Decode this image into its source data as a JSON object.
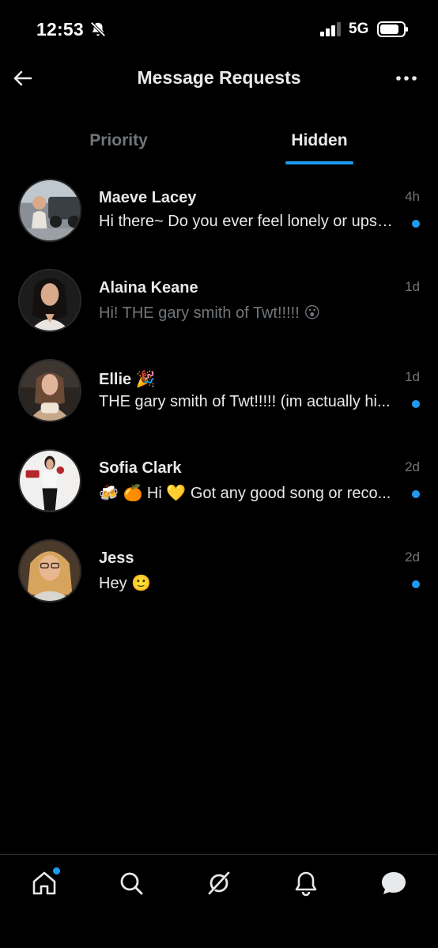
{
  "status_bar": {
    "time": "12:53",
    "network": "5G",
    "icons": [
      "bell-off-icon",
      "signal-icon",
      "battery-icon"
    ]
  },
  "header": {
    "title": "Message Requests",
    "back_icon": "arrow-left-icon",
    "more_icon": "more-horizontal-icon"
  },
  "tabs": [
    {
      "label": "Priority",
      "selected": false
    },
    {
      "label": "Hidden",
      "selected": true
    }
  ],
  "conversations": [
    {
      "name": "Maeve Lacey",
      "time": "4h",
      "snippet": "Hi there~ Do you ever feel lonely or upset sometimes?",
      "unread": true
    },
    {
      "name": "Alaina Keane",
      "time": "1d",
      "snippet": "Hi!   THE gary smith of Twt!!!!! 😮",
      "unread": false
    },
    {
      "name": "Ellie 🎉",
      "time": "1d",
      "snippet": "THE gary smith of Twt!!!!! (im actually hi...",
      "unread": true
    },
    {
      "name": "Sofia Clark",
      "time": "2d",
      "snippet": "🍻 🍊 Hi 💛 Got any good song or reco...",
      "unread": true
    },
    {
      "name": "Jess",
      "time": "2d",
      "snippet": "Hey 🙂",
      "unread": true
    }
  ],
  "bottom_nav": [
    {
      "icon": "home-icon",
      "has_badge": true
    },
    {
      "icon": "search-icon",
      "has_badge": false
    },
    {
      "icon": "grok-icon",
      "has_badge": false
    },
    {
      "icon": "bell-icon",
      "has_badge": false
    },
    {
      "icon": "messages-icon",
      "has_badge": false,
      "selected": true
    }
  ],
  "colors": {
    "background": "#000000",
    "accent": "#1d9bf0",
    "primary_text": "#e7e9ea",
    "secondary_text": "#71767b"
  }
}
